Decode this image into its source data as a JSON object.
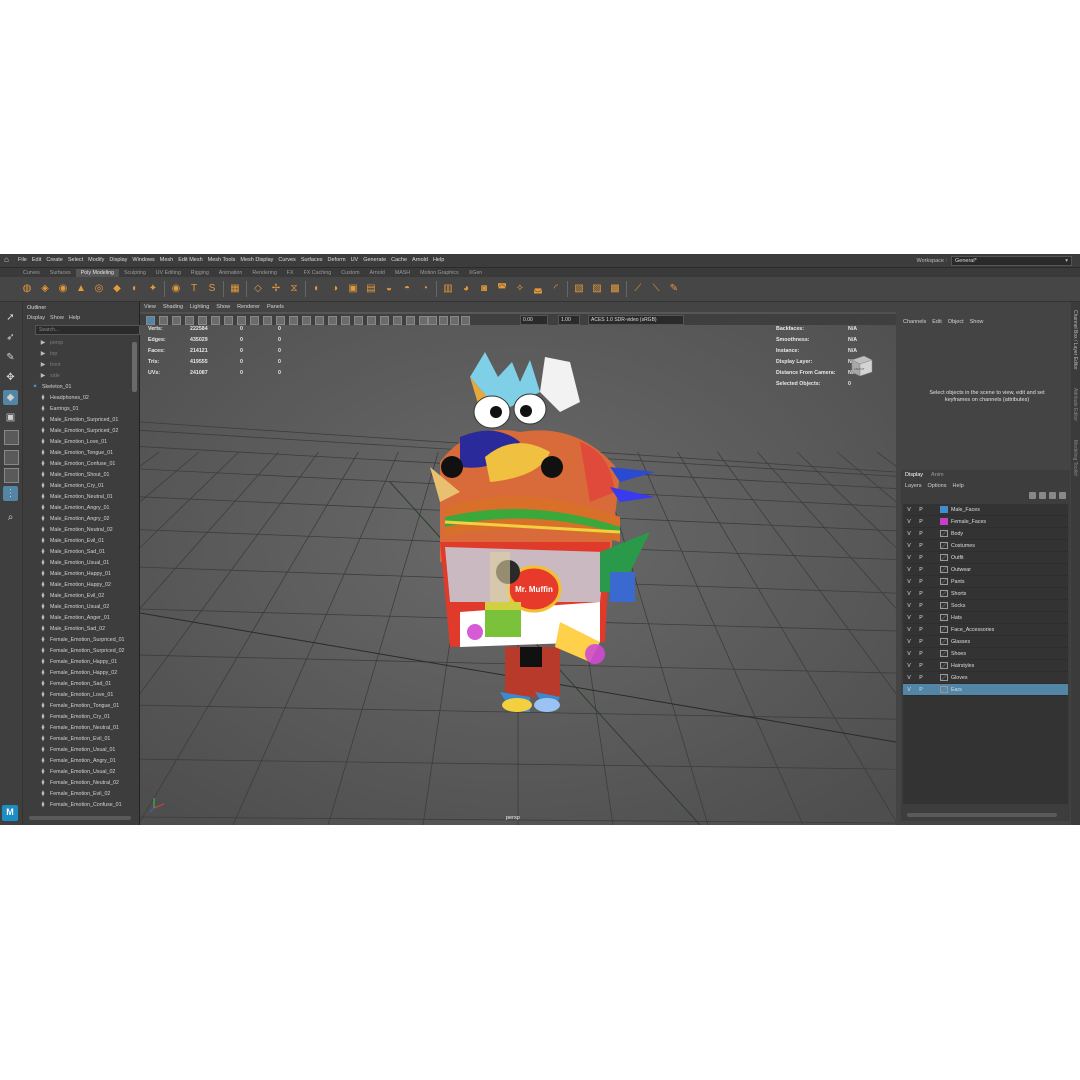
{
  "menu": [
    "File",
    "Edit",
    "Create",
    "Select",
    "Modify",
    "Display",
    "Windows",
    "Mesh",
    "Edit Mesh",
    "Mesh Tools",
    "Mesh Display",
    "Curves",
    "Surfaces",
    "Deform",
    "UV",
    "Generate",
    "Cache",
    "Arnold",
    "Help"
  ],
  "workspace": {
    "label": "Workspace :",
    "value": "General*"
  },
  "shelf_tabs": [
    "Curves",
    "Surfaces",
    "Poly Modeling",
    "Sculpting",
    "UV Editing",
    "Rigging",
    "Animation",
    "Rendering",
    "FX",
    "FX Caching",
    "Custom",
    "Arnold",
    "MASH",
    "Motion Graphics",
    "XGen"
  ],
  "shelf_active_tab": "Poly Modeling",
  "outliner": {
    "title": "Outliner",
    "menu": [
      "Display",
      "Show",
      "Help"
    ],
    "search_placeholder": "Search...",
    "items": [
      {
        "label": "persp",
        "type": "camera"
      },
      {
        "label": "top",
        "type": "camera"
      },
      {
        "label": "front",
        "type": "camera"
      },
      {
        "label": "side",
        "type": "camera"
      },
      {
        "label": "Skeleton_01",
        "type": "skeleton"
      },
      {
        "label": "Headphones_02",
        "type": "mesh"
      },
      {
        "label": "Earrings_01",
        "type": "mesh"
      },
      {
        "label": "Male_Emotion_Surpriced_01",
        "type": "mesh"
      },
      {
        "label": "Male_Emotion_Surpriced_02",
        "type": "mesh"
      },
      {
        "label": "Male_Emotion_Love_01",
        "type": "mesh"
      },
      {
        "label": "Male_Emotion_Tongue_01",
        "type": "mesh"
      },
      {
        "label": "Male_Emotion_Confuse_01",
        "type": "mesh"
      },
      {
        "label": "Male_Emotion_Shout_01",
        "type": "mesh"
      },
      {
        "label": "Male_Emotion_Cry_01",
        "type": "mesh"
      },
      {
        "label": "Male_Emotion_Neutral_01",
        "type": "mesh"
      },
      {
        "label": "Male_Emotion_Angry_01",
        "type": "mesh"
      },
      {
        "label": "Male_Emotion_Angry_02",
        "type": "mesh"
      },
      {
        "label": "Male_Emotion_Neutral_02",
        "type": "mesh"
      },
      {
        "label": "Male_Emotion_Evil_01",
        "type": "mesh"
      },
      {
        "label": "Male_Emotion_Sad_01",
        "type": "mesh"
      },
      {
        "label": "Male_Emotion_Usual_01",
        "type": "mesh"
      },
      {
        "label": "Male_Emotion_Happy_01",
        "type": "mesh"
      },
      {
        "label": "Male_Emotion_Happy_02",
        "type": "mesh"
      },
      {
        "label": "Male_Emotion_Evil_02",
        "type": "mesh"
      },
      {
        "label": "Male_Emotion_Usual_02",
        "type": "mesh"
      },
      {
        "label": "Male_Emotion_Anger_01",
        "type": "mesh"
      },
      {
        "label": "Male_Emotion_Sad_02",
        "type": "mesh"
      },
      {
        "label": "Female_Emotion_Surpriced_01",
        "type": "mesh"
      },
      {
        "label": "Female_Emotion_Surpriced_02",
        "type": "mesh"
      },
      {
        "label": "Female_Emotion_Happy_01",
        "type": "mesh"
      },
      {
        "label": "Female_Emotion_Happy_02",
        "type": "mesh"
      },
      {
        "label": "Female_Emotion_Sad_01",
        "type": "mesh"
      },
      {
        "label": "Female_Emotion_Love_01",
        "type": "mesh"
      },
      {
        "label": "Female_Emotion_Tongue_01",
        "type": "mesh"
      },
      {
        "label": "Female_Emotion_Cry_01",
        "type": "mesh"
      },
      {
        "label": "Female_Emotion_Neutral_01",
        "type": "mesh"
      },
      {
        "label": "Female_Emotion_Evil_01",
        "type": "mesh"
      },
      {
        "label": "Female_Emotion_Usual_01",
        "type": "mesh"
      },
      {
        "label": "Female_Emotion_Angry_01",
        "type": "mesh"
      },
      {
        "label": "Female_Emotion_Usual_02",
        "type": "mesh"
      },
      {
        "label": "Female_Emotion_Neutral_02",
        "type": "mesh"
      },
      {
        "label": "Female_Emotion_Evil_02",
        "type": "mesh"
      },
      {
        "label": "Female_Emotion_Confuse_01",
        "type": "mesh"
      }
    ]
  },
  "viewport": {
    "menu": [
      "View",
      "Shading",
      "Lighting",
      "Show",
      "Renderer",
      "Panels"
    ],
    "exposure": "0.00",
    "gamma": "1.00",
    "color_space": "ACES 1.0 SDR-video (sRGB)",
    "camera": "persp",
    "hud_left": [
      {
        "label": "Verts:",
        "value": "222584",
        "a": "0",
        "b": "0"
      },
      {
        "label": "Edges:",
        "value": "435029",
        "a": "0",
        "b": "0"
      },
      {
        "label": "Faces:",
        "value": "214121",
        "a": "0",
        "b": "0"
      },
      {
        "label": "Tris:",
        "value": "419555",
        "a": "0",
        "b": "0"
      },
      {
        "label": "UVs:",
        "value": "241087",
        "a": "0",
        "b": "0"
      }
    ],
    "hud_right": [
      {
        "label": "Backfaces:",
        "value": "N/A"
      },
      {
        "label": "Smoothness:",
        "value": "N/A"
      },
      {
        "label": "Instance:",
        "value": "N/A"
      },
      {
        "label": "Display Layer:",
        "value": "N/A"
      },
      {
        "label": "Distance From Camera:",
        "value": "N/A"
      },
      {
        "label": "Selected Objects:",
        "value": "0"
      }
    ],
    "view_cube_label": "FRONT",
    "model_sign_text": "Mr. Muffin"
  },
  "channel_box": {
    "menu": [
      "Channels",
      "Edit",
      "Object",
      "Show"
    ],
    "message": "Select objects in the scene to view, edit and set keyframes on channels (attributes)"
  },
  "side_tabs": [
    "Channel Box / Layer Editor",
    "Attribute Editor",
    "Modeling Toolkit"
  ],
  "layer_editor": {
    "tabs": [
      "Display",
      "Anim"
    ],
    "menu": [
      "Layers",
      "Options",
      "Help"
    ],
    "layers": [
      {
        "v": "V",
        "p": "P",
        "name": "Male_Faces",
        "color": "#3f8fd0",
        "selected": false
      },
      {
        "v": "V",
        "p": "P",
        "name": "Female_Faces",
        "color": "#c83ec8",
        "selected": false
      },
      {
        "v": "V",
        "p": "P",
        "name": "Body",
        "color": "",
        "selected": false
      },
      {
        "v": "V",
        "p": "P",
        "name": "Costumes",
        "color": "",
        "selected": false
      },
      {
        "v": "V",
        "p": "P",
        "name": "Outfit",
        "color": "",
        "selected": false
      },
      {
        "v": "V",
        "p": "P",
        "name": "Outwear",
        "color": "",
        "selected": false
      },
      {
        "v": "V",
        "p": "P",
        "name": "Pants",
        "color": "",
        "selected": false
      },
      {
        "v": "V",
        "p": "P",
        "name": "Shorts",
        "color": "",
        "selected": false
      },
      {
        "v": "V",
        "p": "P",
        "name": "Socks",
        "color": "",
        "selected": false
      },
      {
        "v": "V",
        "p": "P",
        "name": "Hats",
        "color": "",
        "selected": false
      },
      {
        "v": "V",
        "p": "P",
        "name": "Face_Accessories",
        "color": "",
        "selected": false
      },
      {
        "v": "V",
        "p": "P",
        "name": "Glasses",
        "color": "",
        "selected": false
      },
      {
        "v": "V",
        "p": "P",
        "name": "Shoes",
        "color": "",
        "selected": false
      },
      {
        "v": "V",
        "p": "P",
        "name": "Hairstyles",
        "color": "",
        "selected": false
      },
      {
        "v": "V",
        "p": "P",
        "name": "Gloves",
        "color": "",
        "selected": false
      },
      {
        "v": "V",
        "p": "P",
        "name": "Ears",
        "color": "",
        "selected": true
      }
    ]
  },
  "colors": {
    "selection": "#5285a6",
    "shelf_icon": "#e59a3a",
    "app_logo": "#1d8ec5"
  },
  "app_logo_text": "M"
}
